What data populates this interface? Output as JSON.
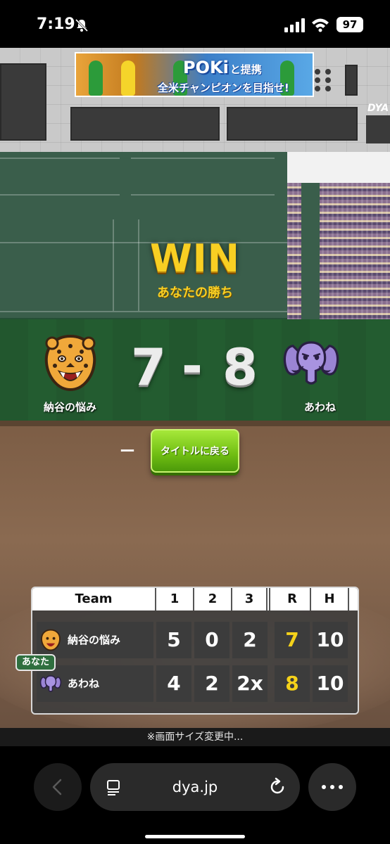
{
  "status": {
    "time": "7:19",
    "battery": "97"
  },
  "banner": {
    "brand": "POKi",
    "brand_suffix": "と提携",
    "subtitle": "全米チャンピオンを目指せ!"
  },
  "stadium": {
    "sign": "DYA"
  },
  "result": {
    "headline": "WIN",
    "subtitle": "あなたの勝ち"
  },
  "teams": {
    "home": {
      "name": "納谷の悩み",
      "score": "7",
      "icon": "leopard-icon"
    },
    "separator": "-",
    "away": {
      "name": "あわね",
      "score": "8",
      "icon": "elephant-icon"
    }
  },
  "actions": {
    "dash": "ー",
    "back_to_title": "タイトルに戻る"
  },
  "scoreboard": {
    "headers": [
      "Team",
      "1",
      "2",
      "3",
      "R",
      "H"
    ],
    "rows": [
      {
        "team": "納谷の悩み",
        "innings": [
          "5",
          "0",
          "2"
        ],
        "runs": "7",
        "hits": "10"
      },
      {
        "team": "あわね",
        "innings": [
          "4",
          "2",
          "2x"
        ],
        "runs": "8",
        "hits": "10"
      }
    ],
    "you_badge": "あなた"
  },
  "footer": {
    "notice": "※画面サイズ変更中..."
  },
  "browser": {
    "url": "dya.jp"
  },
  "colors": {
    "win_gold": "#f8cf23",
    "button_green": "#6fbd12",
    "runs_yellow": "#f5d21a"
  }
}
